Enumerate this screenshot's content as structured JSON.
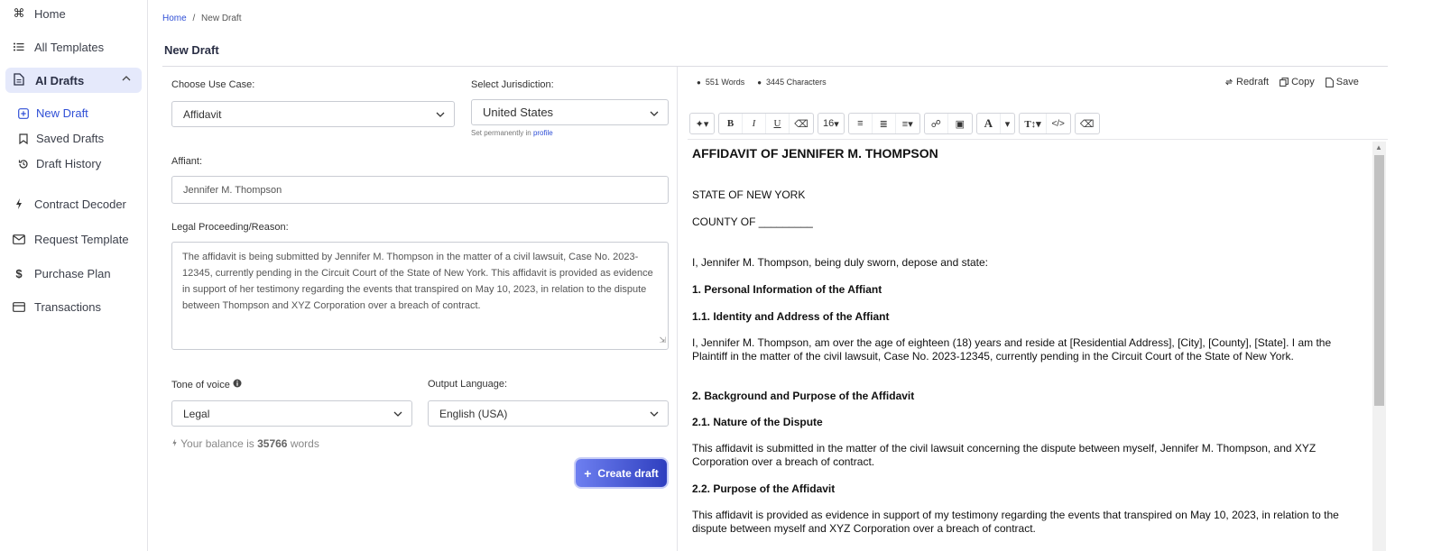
{
  "sidebar": {
    "items": [
      {
        "label": "Home",
        "icon": "command-icon"
      },
      {
        "label": "All Templates",
        "icon": "list-icon"
      },
      {
        "label": "AI Drafts",
        "icon": "document-icon"
      },
      {
        "label": "Contract Decoder",
        "icon": "lightning-icon"
      },
      {
        "label": "Request Template",
        "icon": "envelope-icon"
      },
      {
        "label": "Purchase Plan",
        "icon": "dollar-icon"
      },
      {
        "label": "Transactions",
        "icon": "card-icon"
      }
    ],
    "sub_items": [
      {
        "label": "New Draft",
        "icon": "plus-square-icon"
      },
      {
        "label": "Saved Drafts",
        "icon": "bookmark-icon"
      },
      {
        "label": "Draft History",
        "icon": "history-icon"
      }
    ]
  },
  "breadcrumb": {
    "home": "Home",
    "separator": "/",
    "current": "New Draft"
  },
  "page_title": "New Draft",
  "form": {
    "use_case_label": "Choose Use Case:",
    "use_case_value": "Affidavit",
    "jurisdiction_label": "Select Jurisdiction:",
    "jurisdiction_value": "United States",
    "jurisdiction_hint": "Set permanently in",
    "jurisdiction_hint_link": "profile",
    "affiant_label": "Affiant:",
    "affiant_value": "Jennifer M. Thompson",
    "reason_label": "Legal Proceeding/Reason:",
    "reason_value": "The affidavit is being submitted by Jennifer M. Thompson in the matter of a civil lawsuit, Case No. 2023-12345, currently pending in the Circuit Court of the State of New York. This affidavit is provided as evidence in support of her testimony regarding the events that transpired on May 10, 2023, in relation to the dispute between Thompson and XYZ Corporation over a breach of contract.",
    "tone_label": "Tone of voice",
    "tone_value": "Legal",
    "language_label": "Output Language:",
    "language_value": "English (USA)",
    "balance_prefix": "Your balance is",
    "balance_value": "35766",
    "balance_suffix": "words",
    "create_label": "Create draft"
  },
  "editor": {
    "words": "551 Words",
    "characters": "3445 Characters",
    "actions": {
      "redraft": "Redraft",
      "copy": "Copy",
      "save": "Save"
    },
    "font_size": "16",
    "doc": [
      {
        "style": "h1",
        "text": "AFFIDAVIT OF JENNIFER M. THOMPSON"
      },
      {
        "style": "p",
        "text": "STATE OF NEW YORK"
      },
      {
        "style": "p",
        "text": "COUNTY OF _________"
      },
      {
        "style": "p",
        "text": "I, Jennifer M. Thompson, being duly sworn, depose and state:"
      },
      {
        "style": "h",
        "text": "1. Personal Information of the Affiant"
      },
      {
        "style": "h",
        "text": "1.1. Identity and Address of the Affiant"
      },
      {
        "style": "p",
        "text": "I, Jennifer M. Thompson, am over the age of eighteen (18) years and reside at [Residential Address], [City], [County], [State]. I am the Plaintiff in the matter of the civil lawsuit, Case No. 2023-12345, currently pending in the Circuit Court of the State of New York."
      },
      {
        "style": "h",
        "text": "2. Background and Purpose of the Affidavit"
      },
      {
        "style": "h",
        "text": "2.1. Nature of the Dispute"
      },
      {
        "style": "p",
        "text": "This affidavit is submitted in the matter of the civil lawsuit concerning the dispute between myself, Jennifer M. Thompson, and XYZ Corporation over a breach of contract."
      },
      {
        "style": "h",
        "text": "2.2. Purpose of the Affidavit"
      },
      {
        "style": "p",
        "text": "This affidavit is provided as evidence in support of my testimony regarding the events that transpired on May 10, 2023, in relation to the dispute between myself and XYZ Corporation over a breach of contract."
      }
    ]
  },
  "colors": {
    "accent": "#2f4fd6",
    "active_bg": "#e5e9fb",
    "button_start": "#6d7ff0",
    "button_end": "#2f3fbf"
  }
}
